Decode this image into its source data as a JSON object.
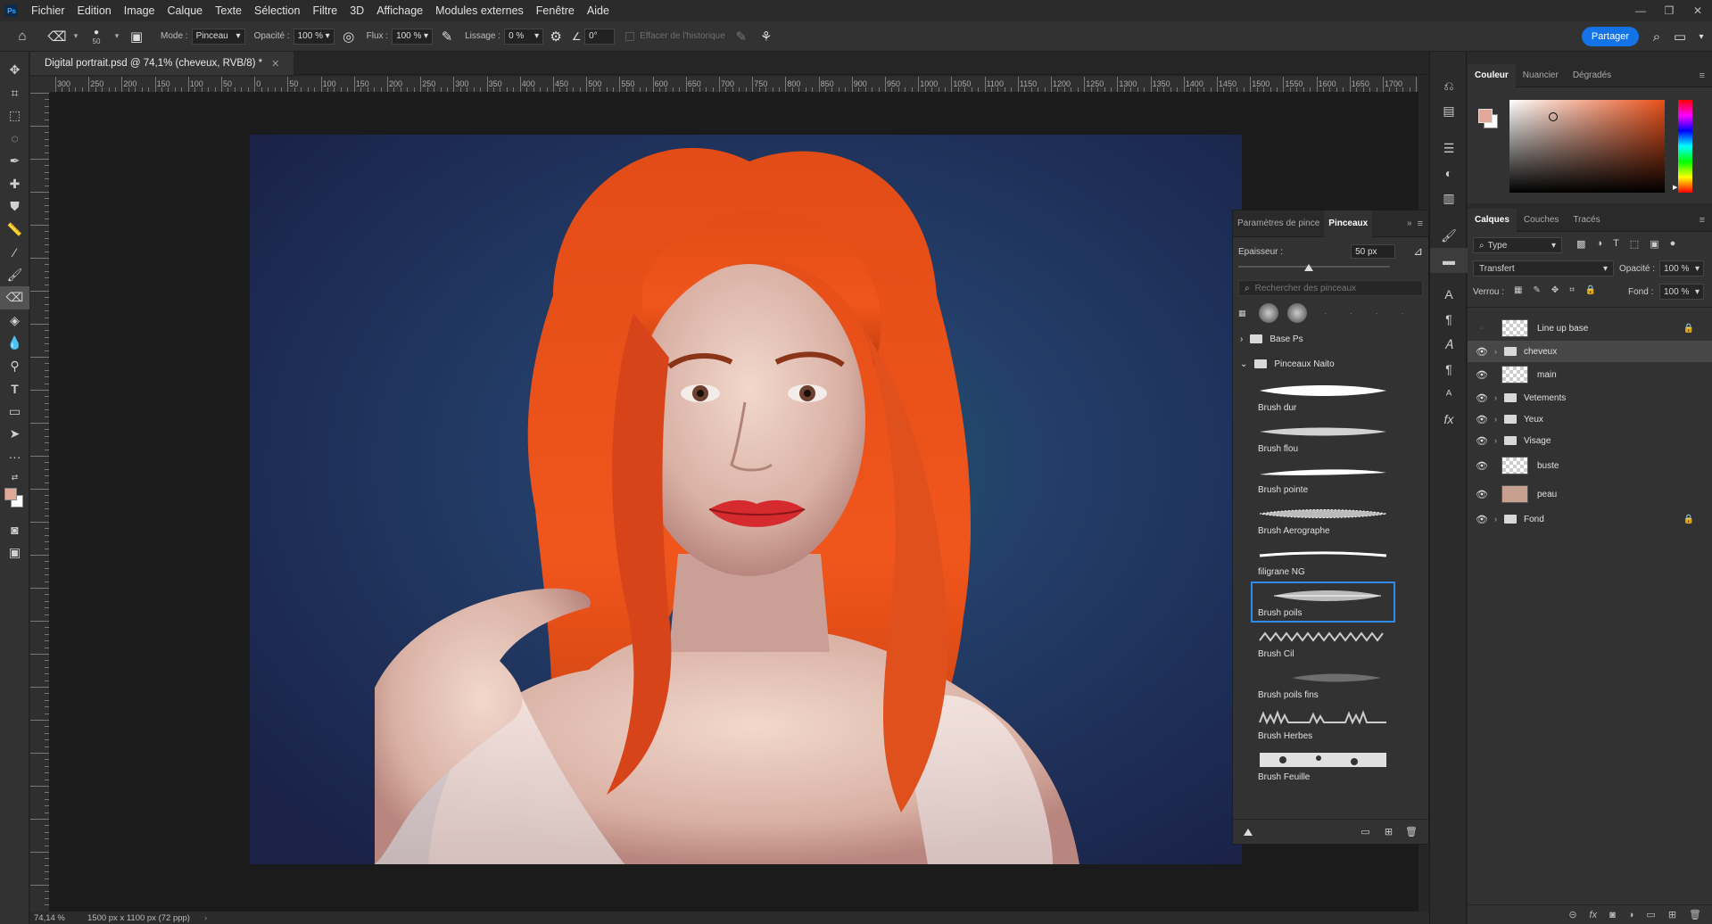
{
  "app": {
    "logo": "Ps"
  },
  "menu": [
    "Fichier",
    "Edition",
    "Image",
    "Calque",
    "Texte",
    "Sélection",
    "Filtre",
    "3D",
    "Affichage",
    "Modules externes",
    "Fenêtre",
    "Aide"
  ],
  "options": {
    "brush_size": "50",
    "mode_label": "Mode :",
    "mode_value": "Pinceau",
    "opacity_label": "Opacité :",
    "opacity_value": "100 %",
    "flow_label": "Flux :",
    "flow_value": "100 %",
    "smoothing_label": "Lissage :",
    "smoothing_value": "0 %",
    "angle_value": "0°",
    "erase_history_label": "Effacer de l'historique",
    "share_label": "Partager"
  },
  "document": {
    "tab_title": "Digital portrait.psd @ 74,1% (cheveux, RVB/8) *",
    "zoom": "74,14 %",
    "doc_info": "1500 px x 1100 px (72 ppp)"
  },
  "ruler_labels": [
    "300",
    "250",
    "200",
    "150",
    "100",
    "50",
    "0",
    "50",
    "100",
    "150",
    "200",
    "250",
    "300",
    "350",
    "400",
    "450",
    "500",
    "550",
    "600",
    "650",
    "700",
    "750",
    "800",
    "850",
    "900",
    "950",
    "1000",
    "1050",
    "1100",
    "1150",
    "1200",
    "1250",
    "1300",
    "1350",
    "1400",
    "1450",
    "1500",
    "1550",
    "1600",
    "1650",
    "1700",
    "17"
  ],
  "brush_panel": {
    "tabs": [
      "Paramètres de pince",
      "Pinceaux"
    ],
    "size_label": "Epaisseur :",
    "size_value": "50 px",
    "search_placeholder": "Rechercher des pinceaux",
    "folders": [
      "Base Ps",
      "Pinceaux Naito"
    ],
    "brushes": [
      "Brush dur",
      "Brush flou",
      "Brush pointe",
      "Brush Aerographe",
      "filigrane NG",
      "Brush poils",
      "Brush Cil",
      "Brush poils fins",
      "Brush Herbes",
      "Brush Feuille"
    ],
    "selected_brush": "Brush poils"
  },
  "color_panel": {
    "tabs": [
      "Couleur",
      "Nuancier",
      "Dégradés"
    ],
    "foreground": "#e0a898",
    "background": "#ffffff",
    "hue_base": "#e8501a"
  },
  "layers_panel": {
    "tabs": [
      "Calques",
      "Couches",
      "Tracés"
    ],
    "filter_value": "Type",
    "blend_mode": "Transfert",
    "opacity_label": "Opacité :",
    "opacity_value": "100 %",
    "lock_label": "Verrou :",
    "fill_label": "Fond :",
    "fill_value": "100 %",
    "layers": [
      {
        "name": "Line up base",
        "kind": "layer",
        "visible": false,
        "locked": true
      },
      {
        "name": "cheveux",
        "kind": "group",
        "visible": true,
        "selected": true
      },
      {
        "name": "main",
        "kind": "layer",
        "visible": true
      },
      {
        "name": "Vetements",
        "kind": "group",
        "visible": true
      },
      {
        "name": "Yeux",
        "kind": "group",
        "visible": true
      },
      {
        "name": "Visage",
        "kind": "group",
        "visible": true
      },
      {
        "name": "buste",
        "kind": "layer",
        "visible": true
      },
      {
        "name": "peau",
        "kind": "layer",
        "visible": true
      },
      {
        "name": "Fond",
        "kind": "group",
        "visible": true,
        "locked": true
      }
    ]
  },
  "colors": {
    "accent": "#1473e6",
    "selection": "#2d8ceb",
    "hair": "#e04a14",
    "background_blue": "#2a3a6a"
  }
}
